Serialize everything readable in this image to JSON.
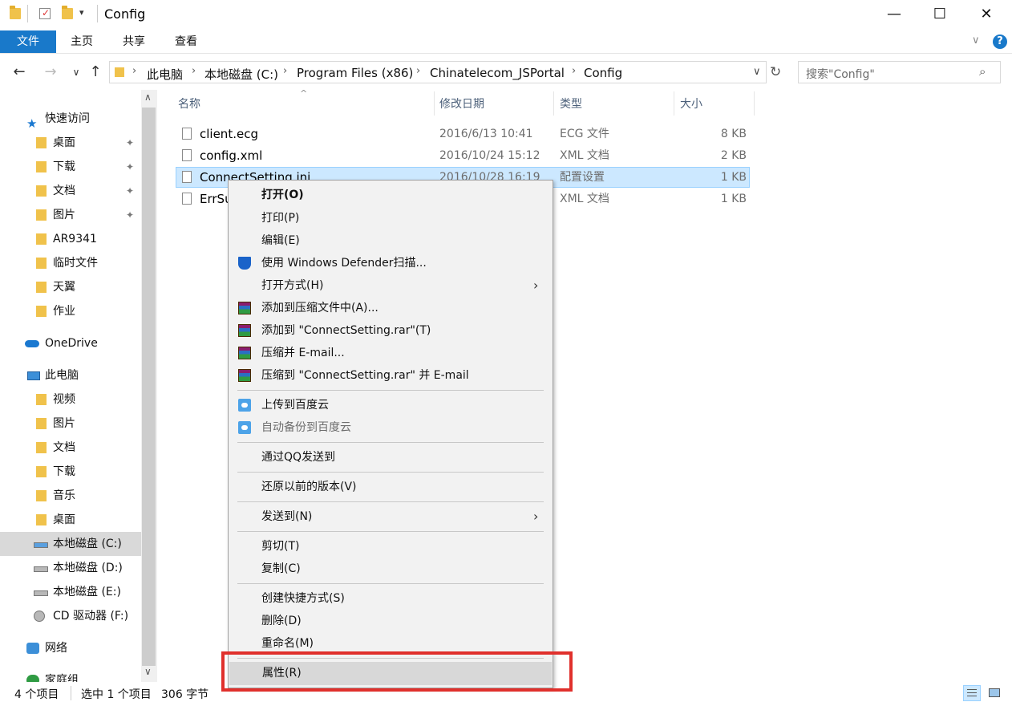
{
  "window": {
    "title": "Config",
    "minimize_glyph": "—",
    "maximize_glyph": "☐",
    "close_glyph": "✕"
  },
  "ribbon": {
    "tabs": [
      "文件",
      "主页",
      "共享",
      "查看"
    ],
    "help_glyph": "?",
    "expand_glyph": "∨"
  },
  "address": {
    "breadcrumb": [
      "此电脑",
      "本地磁盘 (C:)",
      "Program Files (x86)",
      "Chinatelecom_JSPortal",
      "Config"
    ],
    "search_placeholder": "搜索\"Config\""
  },
  "sidebar": {
    "quick_access": "快速访问",
    "quick_items": [
      {
        "label": "桌面",
        "pinned": true,
        "icon": "desktop-folder-icon"
      },
      {
        "label": "下载",
        "pinned": true,
        "icon": "download-folder-icon"
      },
      {
        "label": "文档",
        "pinned": true,
        "icon": "documents-folder-icon"
      },
      {
        "label": "图片",
        "pinned": true,
        "icon": "pictures-folder-icon"
      },
      {
        "label": "AR9341",
        "pinned": false,
        "icon": "folder-icon"
      },
      {
        "label": "临时文件",
        "pinned": false,
        "icon": "folder-icon"
      },
      {
        "label": "天翼",
        "pinned": false,
        "icon": "folder-icon"
      },
      {
        "label": "作业",
        "pinned": false,
        "icon": "folder-icon"
      }
    ],
    "onedrive": "OneDrive",
    "this_pc": "此电脑",
    "pc_items": [
      {
        "label": "视频",
        "icon": "videos-folder-icon"
      },
      {
        "label": "图片",
        "icon": "pictures-folder-icon"
      },
      {
        "label": "文档",
        "icon": "documents-folder-icon"
      },
      {
        "label": "下载",
        "icon": "download-folder-icon"
      },
      {
        "label": "音乐",
        "icon": "music-folder-icon"
      },
      {
        "label": "桌面",
        "icon": "desktop-folder-icon"
      },
      {
        "label": "本地磁盘 (C:)",
        "icon": "system-drive-icon"
      },
      {
        "label": "本地磁盘 (D:)",
        "icon": "drive-icon"
      },
      {
        "label": "本地磁盘 (E:)",
        "icon": "drive-icon"
      },
      {
        "label": "CD 驱动器 (F:)",
        "icon": "cd-drive-icon"
      }
    ],
    "network": "网络",
    "homegroup": "家庭组"
  },
  "file_list": {
    "columns": [
      "名称",
      "修改日期",
      "类型",
      "大小"
    ],
    "files": [
      {
        "name": "client.ecg",
        "date": "2016/6/13 10:41",
        "type": "ECG 文件",
        "size": "8 KB"
      },
      {
        "name": "config.xml",
        "date": "2016/10/24 15:12",
        "type": "XML 文档",
        "size": "2 KB"
      },
      {
        "name": "ConnectSetting.ini",
        "date": "2016/10/28 16:19",
        "type": "配置设置",
        "size": "1 KB"
      },
      {
        "name": "ErrSu",
        "date": "",
        "type": "XML 文档",
        "size": "1 KB"
      }
    ]
  },
  "context_menu": {
    "items": [
      {
        "label": "打开(O)",
        "bold": true
      },
      {
        "label": "打印(P)"
      },
      {
        "label": "编辑(E)"
      },
      {
        "label": "使用 Windows Defender扫描...",
        "icon": "windows-defender-icon"
      },
      {
        "label": "打开方式(H)",
        "submenu": true
      },
      {
        "label": "添加到压缩文件中(A)...",
        "icon": "winrar-icon"
      },
      {
        "label": "添加到 \"ConnectSetting.rar\"(T)",
        "icon": "winrar-icon"
      },
      {
        "label": "压缩并 E-mail...",
        "icon": "winrar-icon"
      },
      {
        "label": "压缩到 \"ConnectSetting.rar\" 并 E-mail",
        "icon": "winrar-icon"
      },
      {
        "label": "上传到百度云",
        "icon": "baidu-cloud-icon"
      },
      {
        "label": "自动备份到百度云",
        "icon": "baidu-cloud-icon",
        "disabled": true
      },
      {
        "label": "通过QQ发送到"
      },
      {
        "label": "还原以前的版本(V)"
      },
      {
        "label": "发送到(N)",
        "submenu": true
      },
      {
        "label": "剪切(T)"
      },
      {
        "label": "复制(C)"
      },
      {
        "label": "创建快捷方式(S)"
      },
      {
        "label": "删除(D)"
      },
      {
        "label": "重命名(M)"
      },
      {
        "label": "属性(R)",
        "highlighted": true
      }
    ]
  },
  "status_bar": {
    "item_count": "4 个项目",
    "selection": "选中 1 个项目",
    "size": "306 字节"
  },
  "colors": {
    "accent": "#1979ca",
    "selection": "#cce8ff",
    "annotation_box": "#e0302c"
  }
}
